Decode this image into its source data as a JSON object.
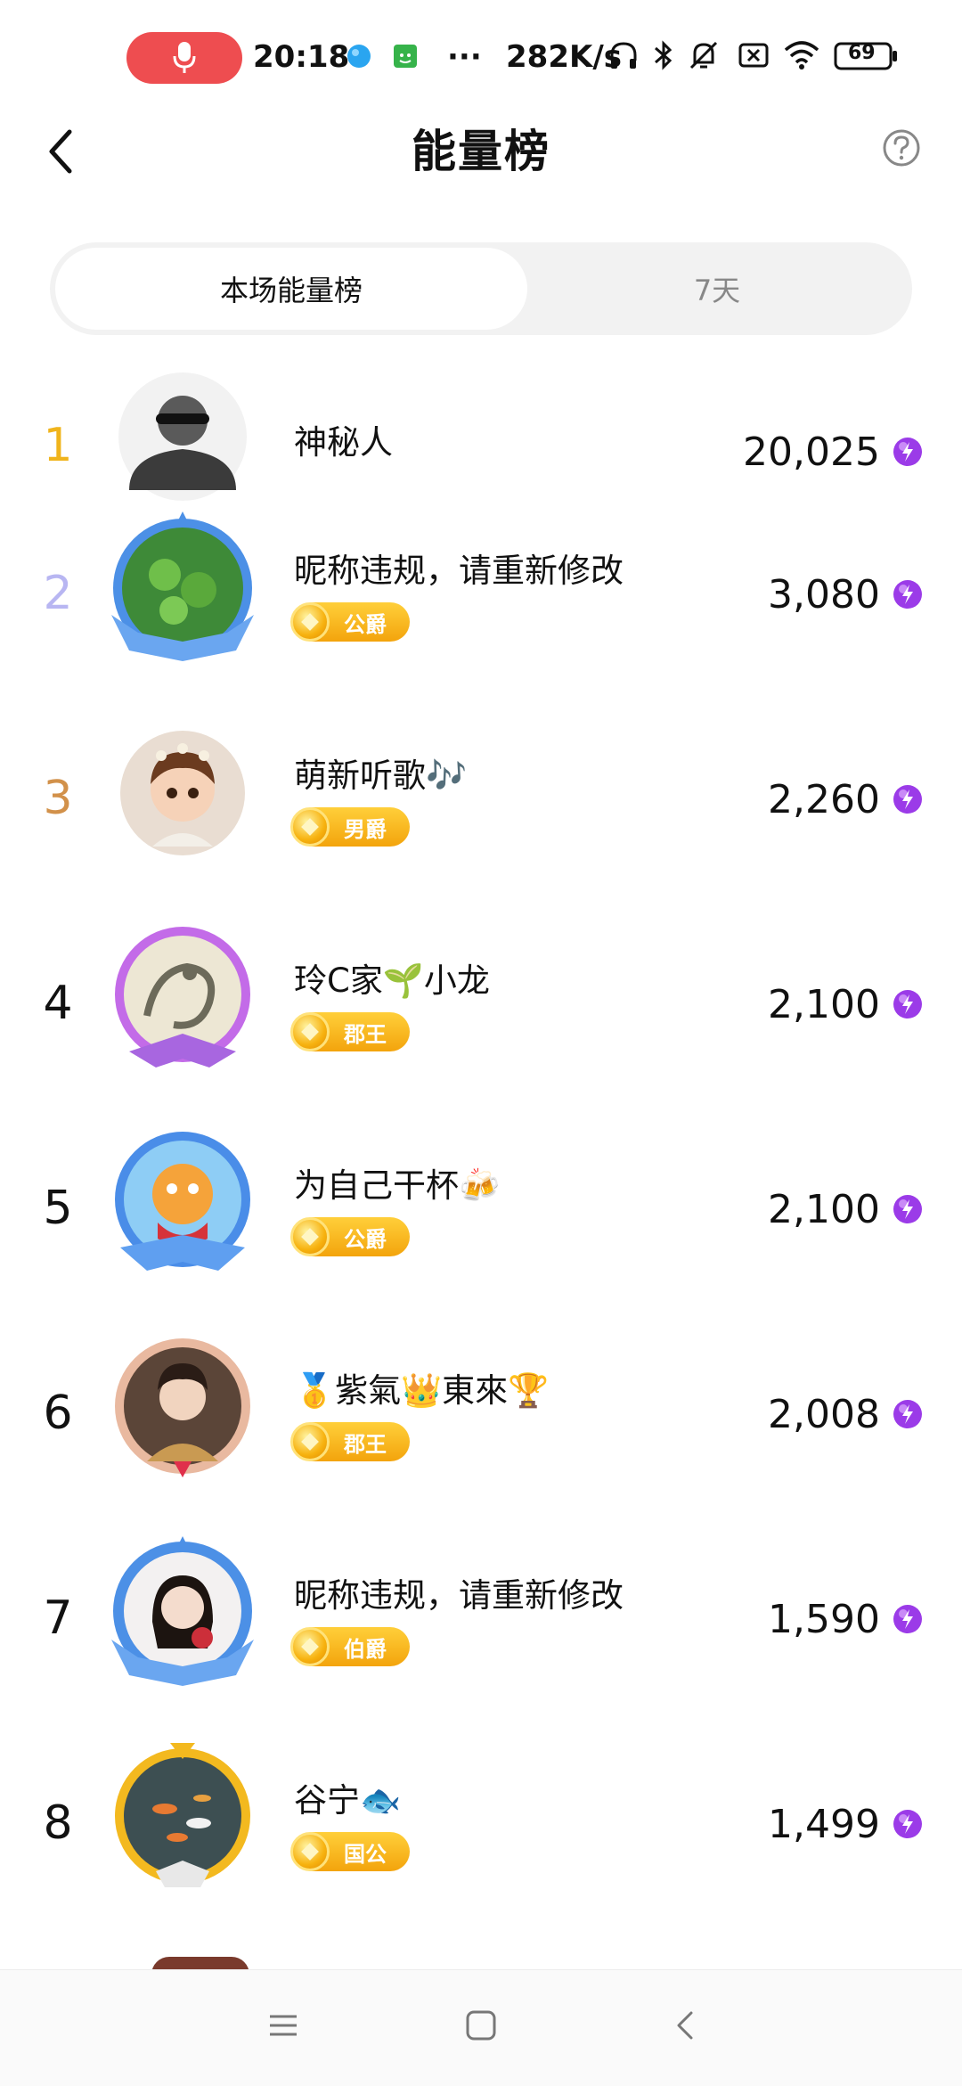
{
  "status_bar": {
    "time": "20:18",
    "more": "···",
    "speed": "282K/s",
    "battery": "69",
    "icons": [
      "mic-icon",
      "app-icon-blue",
      "app-icon-green",
      "headphone-icon",
      "bluetooth-icon",
      "mute-icon",
      "no-sim-icon",
      "wifi-icon",
      "battery-icon"
    ]
  },
  "header": {
    "title": "能量榜",
    "back_icon": "chevron-left-icon",
    "help_icon": "question-circle-icon"
  },
  "tabs": [
    {
      "label": "本场能量榜",
      "active": true
    },
    {
      "label": "7天",
      "active": false
    }
  ],
  "colors": {
    "rank1": "#f0b41c",
    "rank2": "#b8b6f2",
    "rank3": "#d2914a",
    "rank_default": "#111111",
    "badge_gold": "#f5b414",
    "energy_purple": "#9b3be8"
  },
  "leaderboard": [
    {
      "rank": "1",
      "name": "神秘人",
      "badge": "",
      "score": "20,025",
      "avatar": "mystery-person-icon"
    },
    {
      "rank": "2",
      "name": "昵称违规，请重新修改",
      "badge": "公爵",
      "score": "3,080",
      "avatar": "plant-avatar"
    },
    {
      "rank": "3",
      "name": "萌新听歌🎶",
      "badge": "男爵",
      "score": "2,260",
      "avatar": "cartoon-girl-avatar"
    },
    {
      "rank": "4",
      "name": "玲C家🌱小龙",
      "badge": "郡王",
      "score": "2,100",
      "avatar": "dragon-avatar"
    },
    {
      "rank": "5",
      "name": "为自己干杯🍻",
      "badge": "公爵",
      "score": "2,100",
      "avatar": "cartoon-dragon-avatar"
    },
    {
      "rank": "6",
      "name": "🥇紫氣👑東來🏆",
      "badge": "郡王",
      "score": "2,008",
      "avatar": "warrior-avatar"
    },
    {
      "rank": "7",
      "name": "昵称违规，请重新修改",
      "badge": "伯爵",
      "score": "1,590",
      "avatar": "woman-avatar"
    },
    {
      "rank": "8",
      "name": "谷宁🐟",
      "badge": "国公",
      "score": "1,499",
      "avatar": "koi-avatar"
    }
  ],
  "nav_bar": [
    "menu-icon",
    "home-square-icon",
    "back-triangle-icon"
  ]
}
